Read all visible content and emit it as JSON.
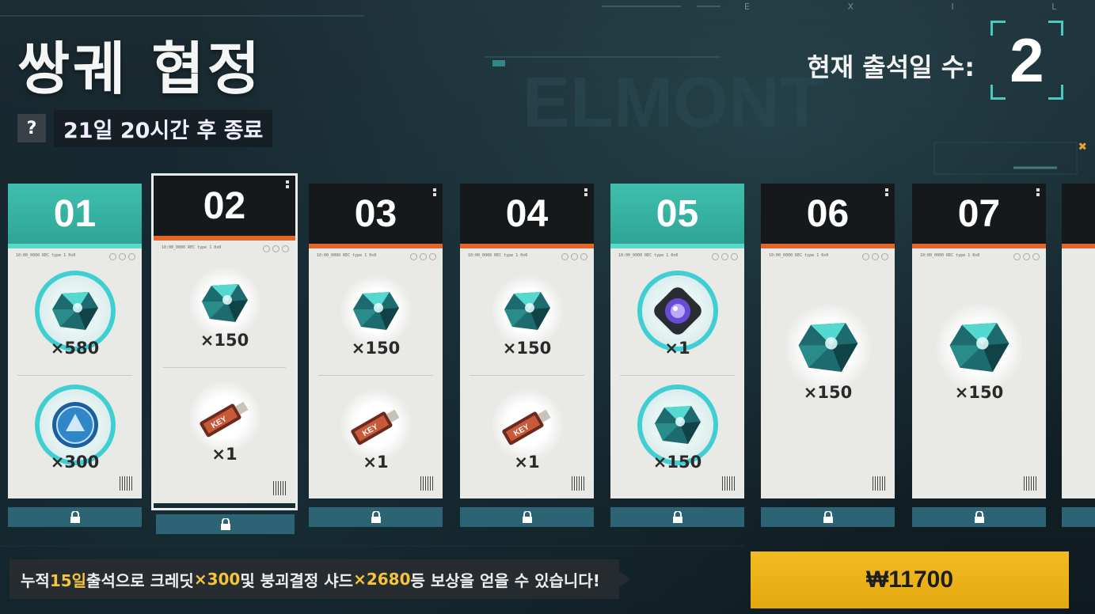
{
  "header": {
    "title": "쌍궤 협정",
    "help_label": "?",
    "timer": "21일 20시간 후 종료",
    "attendance_label": "현재 출석일 수:",
    "attendance_value": "2",
    "brand_letters": "E X I L I U M"
  },
  "cards": [
    {
      "day": "01",
      "state": "claimed",
      "rewards": [
        {
          "icon": "crystal-icon",
          "qty": "×580"
        },
        {
          "icon": "credit-coin-icon",
          "qty": "×300"
        }
      ]
    },
    {
      "day": "02",
      "state": "selected",
      "rewards": [
        {
          "icon": "crystal-icon",
          "qty": "×150"
        },
        {
          "icon": "key-icon",
          "qty": "×1"
        }
      ]
    },
    {
      "day": "03",
      "state": "unclaimed",
      "rewards": [
        {
          "icon": "crystal-icon",
          "qty": "×150"
        },
        {
          "icon": "key-icon",
          "qty": "×1"
        }
      ]
    },
    {
      "day": "04",
      "state": "unclaimed",
      "rewards": [
        {
          "icon": "crystal-icon",
          "qty": "×150"
        },
        {
          "icon": "key-icon",
          "qty": "×1"
        }
      ]
    },
    {
      "day": "05",
      "state": "claimed",
      "rewards": [
        {
          "icon": "core-device-icon",
          "qty": "×1"
        },
        {
          "icon": "crystal-icon",
          "qty": "×150"
        }
      ]
    },
    {
      "day": "06",
      "state": "unclaimed",
      "rewards": [
        {
          "icon": "crystal-icon",
          "qty": "×150"
        }
      ]
    },
    {
      "day": "07",
      "state": "unclaimed",
      "rewards": [
        {
          "icon": "crystal-icon",
          "qty": "×150"
        }
      ]
    }
  ],
  "footer": {
    "msg_prefix": "누적 ",
    "msg_days": "15일",
    "msg_mid1": " 출석으로 크레딧 ",
    "msg_credit": "×300",
    "msg_mid2": " 및 붕괴결정 샤드 ",
    "msg_shard": "×2680",
    "msg_suffix": " 등 보상을 얻을 수 있습니다!",
    "price_label": "₩11700"
  },
  "colors": {
    "claimed_head": "#2ea596",
    "unclaimed_stripe": "#e2652a",
    "accent_ring": "#3fcfd2",
    "buy_button": "#f3bb22",
    "highlight_text": "#f3c53d",
    "lock_bar": "#2d6475"
  }
}
